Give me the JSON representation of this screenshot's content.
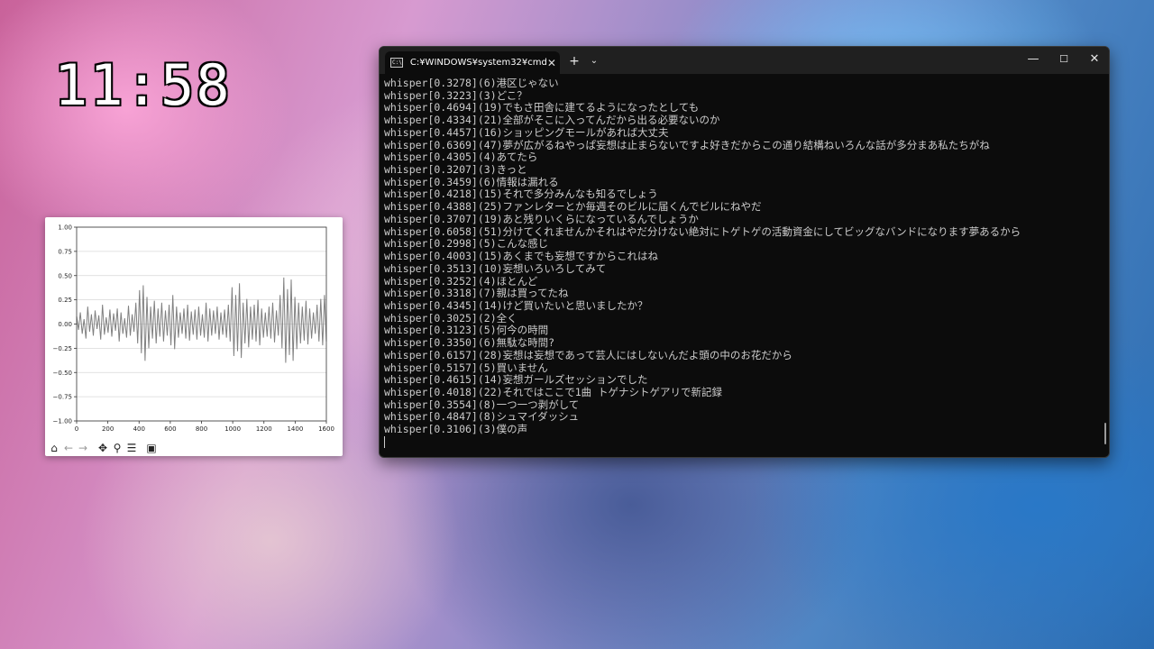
{
  "clock": {
    "time": "11:58"
  },
  "plot_window": {
    "toolbar_icons": [
      "home-icon",
      "back-arrow-icon",
      "forward-arrow-icon",
      "pan-move-icon",
      "zoom-magnifier-icon",
      "configure-subplots-icon",
      "save-floppy-icon"
    ]
  },
  "chart_data": {
    "type": "line",
    "title": "",
    "xlabel": "",
    "ylabel": "",
    "xlim": [
      0,
      1600
    ],
    "ylim": [
      -1.0,
      1.0
    ],
    "xticks": [
      "0",
      "200",
      "400",
      "600",
      "800",
      "1000",
      "1200",
      "1400",
      "1600"
    ],
    "yticks": [
      "1.00",
      "0.75",
      "0.50",
      "0.25",
      "0.00",
      "−0.25",
      "−0.50",
      "−0.75",
      "−1.00"
    ],
    "grid": true,
    "color": "#808080",
    "series": [
      {
        "values": [
          0.08,
          -0.06,
          0.12,
          -0.1,
          0.05,
          -0.15,
          0.18,
          -0.08,
          0.1,
          -0.12,
          0.14,
          -0.05,
          0.09,
          -0.16,
          0.2,
          -0.11,
          0.07,
          -0.09,
          0.15,
          -0.13,
          0.11,
          -0.07,
          0.16,
          -0.18,
          0.12,
          -0.1,
          0.06,
          -0.14,
          0.19,
          -0.12,
          0.1,
          -0.08,
          0.22,
          -0.2,
          0.35,
          -0.3,
          0.4,
          -0.38,
          0.28,
          -0.25,
          0.18,
          -0.15,
          0.24,
          -0.2,
          0.16,
          -0.13,
          0.22,
          -0.18,
          0.14,
          -0.12,
          0.2,
          -0.22,
          0.3,
          -0.26,
          0.18,
          -0.14,
          0.12,
          -0.1,
          0.16,
          -0.15,
          0.2,
          -0.17,
          0.13,
          -0.11,
          0.15,
          -0.16,
          0.18,
          -0.12,
          0.1,
          -0.14,
          0.22,
          -0.18,
          0.16,
          -0.12,
          0.14,
          -0.1,
          0.18,
          -0.16,
          0.12,
          -0.11,
          0.15,
          -0.14,
          0.2,
          -0.18,
          0.38,
          -0.33,
          0.3,
          -0.28,
          0.42,
          -0.35,
          0.22,
          -0.2,
          0.26,
          -0.24,
          0.18,
          -0.16,
          0.2,
          -0.18,
          0.25,
          -0.22,
          0.16,
          -0.14,
          0.12,
          -0.13,
          0.18,
          -0.15,
          0.22,
          -0.19,
          0.14,
          -0.12,
          0.3,
          -0.25,
          0.48,
          -0.4,
          0.36,
          -0.32,
          0.46,
          -0.38,
          0.28,
          -0.26,
          0.22,
          -0.2,
          0.18,
          -0.17,
          0.24,
          -0.21,
          0.16,
          -0.15,
          0.12,
          -0.1,
          0.2,
          -0.18,
          0.26,
          -0.22,
          0.3,
          -0.18
        ]
      }
    ]
  },
  "terminal": {
    "tab_title": "C:¥WINDOWS¥system32¥cmd",
    "tab_close": "✕",
    "new_tab": "+",
    "dropdown": "⌄",
    "minimize": "—",
    "maximize": "☐",
    "close": "✕",
    "lines": [
      "whisper[0.3278](6)港区じゃない",
      "whisper[0.3223](3)どこ？",
      "whisper[0.4694](19)でもさ田舎に建てるようになったとしても",
      "whisper[0.4334](21)全部がそこに入ってんだから出る必要ないのか",
      "whisper[0.4457](16)ショッピングモールがあれば大丈夫",
      "whisper[0.6369](47)夢が広がるねやっぱ妄想は止まらないですよ好きだからこの通り結構ねいろんな話が多分まあ私たちがね",
      "whisper[0.4305](4)あてたら",
      "whisper[0.3207](3)きっと",
      "whisper[0.3459](6)情報は漏れる",
      "whisper[0.4218](15)それで多分みんなも知るでしょう",
      "whisper[0.4388](25)ファンレターとか毎週そのビルに届くんでビルにねやだ",
      "whisper[0.3707](19)あと残りいくらになっているんでしょうか",
      "whisper[0.6058](51)分けてくれませんかそれはやだ分けない絶対にトゲトゲの活動資金にしてビッグなバンドになります夢あるから",
      "whisper[0.2998](5)こんな感じ",
      "whisper[0.4003](15)あくまでも妄想ですからこれはね",
      "whisper[0.3513](10)妄想いろいろしてみて",
      "whisper[0.3252](4)ほとんど",
      "whisper[0.3318](7)親は買ってたね",
      "whisper[0.4345](14)けど買いたいと思いましたか？",
      "whisper[0.3025](2)全く",
      "whisper[0.3123](5)何今の時間",
      "whisper[0.3350](6)無駄な時間?",
      "whisper[0.6157](28)妄想は妄想であって芸人にはしないんだよ頭の中のお花だから",
      "whisper[0.5157](5)買いません",
      "whisper[0.4615](14)妄想ガールズセッションでした",
      "whisper[0.4018](22)それではここで1曲 トゲナシトゲアリで新記録",
      "whisper[0.3554](8)一つ一つ剥がして",
      "whisper[0.4847](8)シュマイダッシュ",
      "whisper[0.3106](3)僕の声"
    ]
  }
}
